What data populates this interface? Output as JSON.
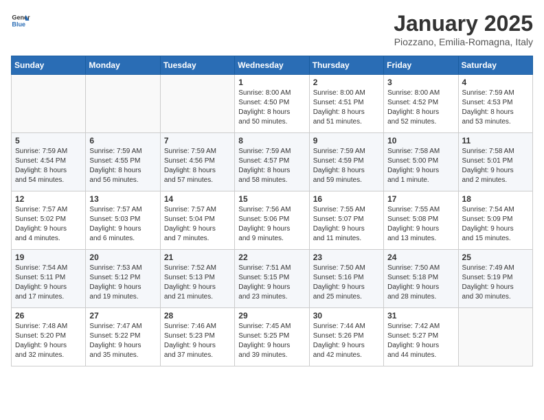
{
  "header": {
    "logo_general": "General",
    "logo_blue": "Blue",
    "title": "January 2025",
    "subtitle": "Piozzano, Emilia-Romagna, Italy"
  },
  "weekdays": [
    "Sunday",
    "Monday",
    "Tuesday",
    "Wednesday",
    "Thursday",
    "Friday",
    "Saturday"
  ],
  "weeks": [
    [
      {
        "day": "",
        "info": ""
      },
      {
        "day": "",
        "info": ""
      },
      {
        "day": "",
        "info": ""
      },
      {
        "day": "1",
        "info": "Sunrise: 8:00 AM\nSunset: 4:50 PM\nDaylight: 8 hours\nand 50 minutes."
      },
      {
        "day": "2",
        "info": "Sunrise: 8:00 AM\nSunset: 4:51 PM\nDaylight: 8 hours\nand 51 minutes."
      },
      {
        "day": "3",
        "info": "Sunrise: 8:00 AM\nSunset: 4:52 PM\nDaylight: 8 hours\nand 52 minutes."
      },
      {
        "day": "4",
        "info": "Sunrise: 7:59 AM\nSunset: 4:53 PM\nDaylight: 8 hours\nand 53 minutes."
      }
    ],
    [
      {
        "day": "5",
        "info": "Sunrise: 7:59 AM\nSunset: 4:54 PM\nDaylight: 8 hours\nand 54 minutes."
      },
      {
        "day": "6",
        "info": "Sunrise: 7:59 AM\nSunset: 4:55 PM\nDaylight: 8 hours\nand 56 minutes."
      },
      {
        "day": "7",
        "info": "Sunrise: 7:59 AM\nSunset: 4:56 PM\nDaylight: 8 hours\nand 57 minutes."
      },
      {
        "day": "8",
        "info": "Sunrise: 7:59 AM\nSunset: 4:57 PM\nDaylight: 8 hours\nand 58 minutes."
      },
      {
        "day": "9",
        "info": "Sunrise: 7:59 AM\nSunset: 4:59 PM\nDaylight: 8 hours\nand 59 minutes."
      },
      {
        "day": "10",
        "info": "Sunrise: 7:58 AM\nSunset: 5:00 PM\nDaylight: 9 hours\nand 1 minute."
      },
      {
        "day": "11",
        "info": "Sunrise: 7:58 AM\nSunset: 5:01 PM\nDaylight: 9 hours\nand 2 minutes."
      }
    ],
    [
      {
        "day": "12",
        "info": "Sunrise: 7:57 AM\nSunset: 5:02 PM\nDaylight: 9 hours\nand 4 minutes."
      },
      {
        "day": "13",
        "info": "Sunrise: 7:57 AM\nSunset: 5:03 PM\nDaylight: 9 hours\nand 6 minutes."
      },
      {
        "day": "14",
        "info": "Sunrise: 7:57 AM\nSunset: 5:04 PM\nDaylight: 9 hours\nand 7 minutes."
      },
      {
        "day": "15",
        "info": "Sunrise: 7:56 AM\nSunset: 5:06 PM\nDaylight: 9 hours\nand 9 minutes."
      },
      {
        "day": "16",
        "info": "Sunrise: 7:55 AM\nSunset: 5:07 PM\nDaylight: 9 hours\nand 11 minutes."
      },
      {
        "day": "17",
        "info": "Sunrise: 7:55 AM\nSunset: 5:08 PM\nDaylight: 9 hours\nand 13 minutes."
      },
      {
        "day": "18",
        "info": "Sunrise: 7:54 AM\nSunset: 5:09 PM\nDaylight: 9 hours\nand 15 minutes."
      }
    ],
    [
      {
        "day": "19",
        "info": "Sunrise: 7:54 AM\nSunset: 5:11 PM\nDaylight: 9 hours\nand 17 minutes."
      },
      {
        "day": "20",
        "info": "Sunrise: 7:53 AM\nSunset: 5:12 PM\nDaylight: 9 hours\nand 19 minutes."
      },
      {
        "day": "21",
        "info": "Sunrise: 7:52 AM\nSunset: 5:13 PM\nDaylight: 9 hours\nand 21 minutes."
      },
      {
        "day": "22",
        "info": "Sunrise: 7:51 AM\nSunset: 5:15 PM\nDaylight: 9 hours\nand 23 minutes."
      },
      {
        "day": "23",
        "info": "Sunrise: 7:50 AM\nSunset: 5:16 PM\nDaylight: 9 hours\nand 25 minutes."
      },
      {
        "day": "24",
        "info": "Sunrise: 7:50 AM\nSunset: 5:18 PM\nDaylight: 9 hours\nand 28 minutes."
      },
      {
        "day": "25",
        "info": "Sunrise: 7:49 AM\nSunset: 5:19 PM\nDaylight: 9 hours\nand 30 minutes."
      }
    ],
    [
      {
        "day": "26",
        "info": "Sunrise: 7:48 AM\nSunset: 5:20 PM\nDaylight: 9 hours\nand 32 minutes."
      },
      {
        "day": "27",
        "info": "Sunrise: 7:47 AM\nSunset: 5:22 PM\nDaylight: 9 hours\nand 35 minutes."
      },
      {
        "day": "28",
        "info": "Sunrise: 7:46 AM\nSunset: 5:23 PM\nDaylight: 9 hours\nand 37 minutes."
      },
      {
        "day": "29",
        "info": "Sunrise: 7:45 AM\nSunset: 5:25 PM\nDaylight: 9 hours\nand 39 minutes."
      },
      {
        "day": "30",
        "info": "Sunrise: 7:44 AM\nSunset: 5:26 PM\nDaylight: 9 hours\nand 42 minutes."
      },
      {
        "day": "31",
        "info": "Sunrise: 7:42 AM\nSunset: 5:27 PM\nDaylight: 9 hours\nand 44 minutes."
      },
      {
        "day": "",
        "info": ""
      }
    ]
  ]
}
